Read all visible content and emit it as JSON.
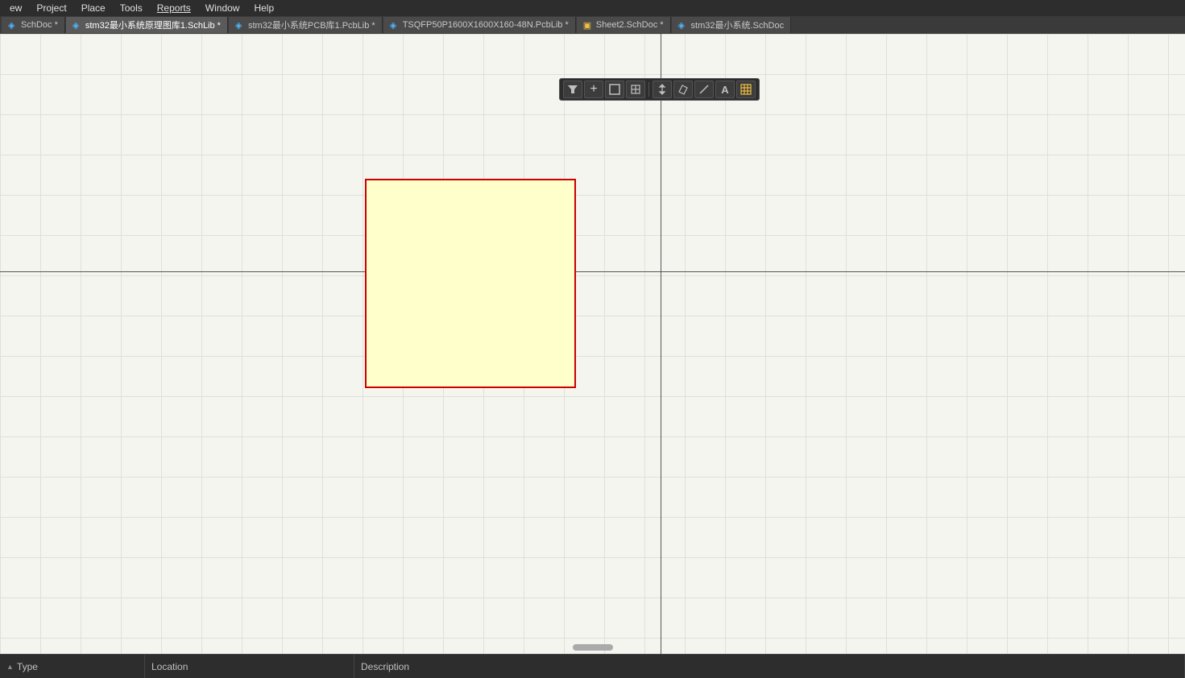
{
  "menubar": {
    "items": [
      {
        "label": "ew",
        "underline": false
      },
      {
        "label": "Project",
        "underline": false
      },
      {
        "label": "Place",
        "underline": false
      },
      {
        "label": "Tools",
        "underline": false
      },
      {
        "label": "Reports",
        "underline": true
      },
      {
        "label": "Window",
        "underline": false
      },
      {
        "label": "Help",
        "underline": false
      }
    ]
  },
  "tabs": [
    {
      "id": "schdoc",
      "label": "SchDoc *",
      "icon_type": "schlib",
      "active": false
    },
    {
      "id": "schlib1",
      "label": "stm32最小系统原理图库1.SchLib *",
      "icon_type": "schlib",
      "active": true
    },
    {
      "id": "pcblib1",
      "label": "stm32最小系统PCB库1.PcbLib *",
      "icon_type": "pcblib",
      "active": false
    },
    {
      "id": "pcblib2",
      "label": "TSQFP50P1600X1600X160-48N.PcbLib *",
      "icon_type": "pcblib",
      "active": false
    },
    {
      "id": "sheet2",
      "label": "Sheet2.SchDoc *",
      "icon_type": "folder",
      "active": false
    },
    {
      "id": "schlib2",
      "label": "stm32最小系统.SchDoc",
      "icon_type": "schlib",
      "active": false
    }
  ],
  "toolbar": {
    "buttons": [
      {
        "id": "filter",
        "icon": "▼",
        "tooltip": "Filter"
      },
      {
        "id": "add",
        "icon": "+",
        "tooltip": "Add"
      },
      {
        "id": "rect-select",
        "icon": "□",
        "tooltip": "Rectangle Select"
      },
      {
        "id": "pin",
        "icon": "⊕",
        "tooltip": "Pin"
      },
      {
        "id": "move",
        "icon": "✥",
        "tooltip": "Move"
      },
      {
        "id": "eraser",
        "icon": "◇",
        "tooltip": "Eraser"
      },
      {
        "id": "line",
        "icon": "/",
        "tooltip": "Line"
      },
      {
        "id": "text",
        "icon": "A",
        "tooltip": "Text"
      },
      {
        "id": "component",
        "icon": "▦",
        "tooltip": "Component"
      }
    ]
  },
  "statusbar": {
    "type_label": "Type",
    "location_label": "Location",
    "description_label": "Description",
    "sort_indicator": "▲"
  }
}
